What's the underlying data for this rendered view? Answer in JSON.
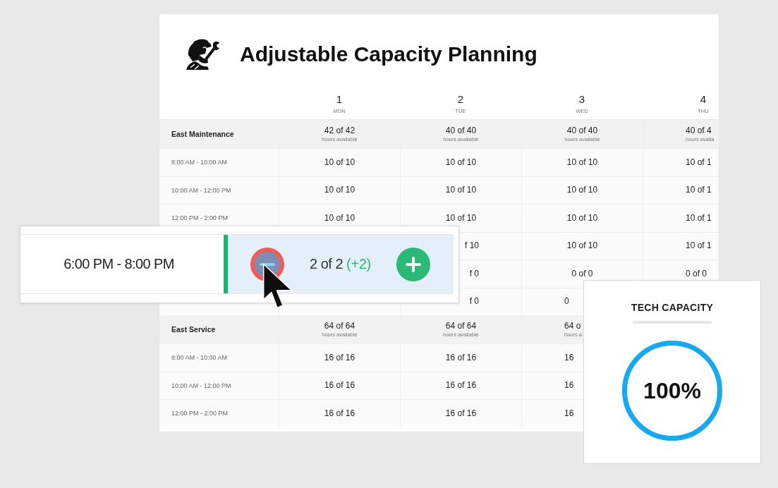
{
  "header": {
    "title": "Adjustable Capacity Planning"
  },
  "schedule": {
    "days": [
      {
        "number": "1",
        "weekday": "MON"
      },
      {
        "number": "2",
        "weekday": "TUE"
      },
      {
        "number": "3",
        "weekday": "WED"
      },
      {
        "number": "4",
        "weekday": "THU"
      }
    ],
    "groups": [
      {
        "name": "East Maintenance",
        "totals": [
          {
            "value": "42 of 42",
            "caption": "hours available"
          },
          {
            "value": "40 of 40",
            "caption": "hours available"
          },
          {
            "value": "40 of 40",
            "caption": "hours available"
          },
          {
            "value": "40 of 4",
            "caption": "hours availa"
          }
        ],
        "slots": [
          {
            "time": "8:00 AM - 10:00 AM",
            "cells": [
              "10 of 10",
              "10 of 10",
              "10 of 10",
              "10 of 1"
            ]
          },
          {
            "time": "10:00 AM - 12:00 PM",
            "cells": [
              "10 of 10",
              "10 of 10",
              "10 of 10",
              "10 of 1"
            ]
          },
          {
            "time": "12:00 PM - 2:00 PM",
            "cells": [
              "10 of 10",
              "10 of 10",
              "10 of 10",
              "10 of 1"
            ]
          },
          {
            "cells": [
              null,
              "f 10",
              "10 of 10",
              "10 of 1"
            ]
          },
          {
            "cells": [
              null,
              "f 0",
              "0 of 0",
              "0 of 0"
            ]
          },
          {
            "cells": [
              null,
              "f 0",
              "0"
            ]
          }
        ]
      },
      {
        "name": "East Service",
        "totals": [
          {
            "value": "64 of 64",
            "caption": "hours available"
          },
          {
            "value": "64 of 64",
            "caption": "hours available"
          },
          {
            "value": "64 o",
            "caption": "hours a"
          }
        ],
        "slots": [
          {
            "time": "8:00 AM - 10:00 AM",
            "cells": [
              "16 of 16",
              "16 of 16",
              "16"
            ]
          },
          {
            "time": "10:00 AM - 12:00 PM",
            "cells": [
              "16 of 16",
              "16 of 16",
              "16"
            ]
          },
          {
            "time": "12:00 PM - 2:00 PM",
            "cells": [
              "16 of 16",
              "16 of 16",
              "16"
            ]
          }
        ]
      }
    ]
  },
  "slot_editor": {
    "time": "6:00 PM - 8:00 PM",
    "selected": true,
    "count": "2 of 2",
    "change": "(+2)",
    "buttons": [
      {
        "kind": "decrease",
        "hovered": true
      },
      {
        "kind": "increase",
        "hovered": false
      }
    ]
  },
  "tech_capacity": {
    "title": "TECH CAPACITY",
    "percent": "100%",
    "level": 1
  }
}
